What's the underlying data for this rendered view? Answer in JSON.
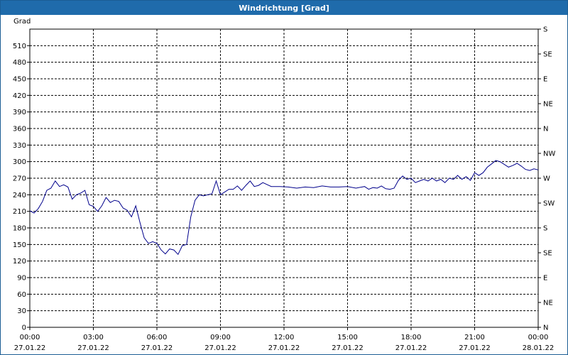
{
  "window": {
    "title": "Windrichtung [Grad]"
  },
  "chart_data": {
    "type": "line",
    "title": "Windrichtung [Grad]",
    "ylabel": "Grad",
    "xlabel": "",
    "ylim": [
      0,
      540
    ],
    "xlim": [
      0,
      24
    ],
    "grid": true,
    "y_ticks": [
      0,
      30,
      60,
      90,
      120,
      150,
      180,
      210,
      240,
      270,
      300,
      330,
      360,
      390,
      420,
      450,
      480,
      510
    ],
    "y2_ticks": [
      {
        "value": 0,
        "label": "N"
      },
      {
        "value": 45,
        "label": "NE"
      },
      {
        "value": 90,
        "label": "E"
      },
      {
        "value": 135,
        "label": "SE"
      },
      {
        "value": 180,
        "label": "S"
      },
      {
        "value": 225,
        "label": "SW"
      },
      {
        "value": 270,
        "label": "W"
      },
      {
        "value": 315,
        "label": "NW"
      },
      {
        "value": 360,
        "label": "N"
      },
      {
        "value": 405,
        "label": "NE"
      },
      {
        "value": 450,
        "label": "E"
      },
      {
        "value": 495,
        "label": "SE"
      },
      {
        "value": 540,
        "label": "S"
      }
    ],
    "x_ticks": [
      {
        "value": 0,
        "time": "00:00",
        "date": "27.01.22"
      },
      {
        "value": 3,
        "time": "03:00",
        "date": "27.01.22"
      },
      {
        "value": 6,
        "time": "06:00",
        "date": "27.01.22"
      },
      {
        "value": 9,
        "time": "09:00",
        "date": "27.01.22"
      },
      {
        "value": 12,
        "time": "12:00",
        "date": "27.01.22"
      },
      {
        "value": 15,
        "time": "15:00",
        "date": "27.01.22"
      },
      {
        "value": 18,
        "time": "18:00",
        "date": "27.01.22"
      },
      {
        "value": 21,
        "time": "21:00",
        "date": "27.01.22"
      },
      {
        "value": 24,
        "time": "00:00",
        "date": "28.01.22"
      }
    ],
    "series": [
      {
        "color": "#00008b",
        "x": [
          0,
          0.2,
          0.4,
          0.6,
          0.8,
          1.0,
          1.2,
          1.4,
          1.6,
          1.8,
          2.0,
          2.2,
          2.4,
          2.6,
          2.8,
          3.0,
          3.2,
          3.4,
          3.6,
          3.8,
          4.0,
          4.2,
          4.4,
          4.6,
          4.8,
          5.0,
          5.2,
          5.4,
          5.6,
          5.8,
          6.0,
          6.2,
          6.4,
          6.6,
          6.8,
          7.0,
          7.2,
          7.4,
          7.6,
          7.8,
          8.0,
          8.2,
          8.4,
          8.6,
          8.8,
          9.0,
          9.2,
          9.4,
          9.6,
          9.8,
          10.0,
          10.2,
          10.4,
          10.6,
          10.8,
          11.0,
          11.4,
          11.8,
          12.2,
          12.6,
          13.0,
          13.4,
          13.8,
          14.2,
          14.6,
          15.0,
          15.4,
          15.8,
          16.0,
          16.2,
          16.4,
          16.6,
          16.8,
          17.0,
          17.2,
          17.4,
          17.6,
          17.8,
          18.0,
          18.2,
          18.4,
          18.6,
          18.8,
          19.0,
          19.2,
          19.4,
          19.6,
          19.8,
          20.0,
          20.2,
          20.4,
          20.6,
          20.8,
          21.0,
          21.2,
          21.4,
          21.6,
          21.8,
          22.0,
          22.2,
          22.4,
          22.6,
          22.8,
          23.0,
          23.2,
          23.4,
          23.6,
          23.8,
          24.0
        ],
        "y": [
          211,
          207,
          215,
          228,
          248,
          252,
          265,
          255,
          258,
          254,
          232,
          240,
          243,
          248,
          222,
          219,
          210,
          220,
          235,
          226,
          230,
          228,
          216,
          212,
          200,
          220,
          190,
          162,
          152,
          155,
          152,
          140,
          133,
          142,
          140,
          132,
          148,
          150,
          200,
          230,
          240,
          238,
          240,
          242,
          265,
          240,
          245,
          250,
          250,
          256,
          248,
          257,
          265,
          255,
          257,
          262,
          255,
          255,
          254,
          252,
          254,
          253,
          256,
          254,
          254,
          255,
          252,
          255,
          250,
          253,
          252,
          256,
          251,
          250,
          252,
          266,
          274,
          268,
          270,
          262,
          265,
          268,
          265,
          270,
          265,
          268,
          262,
          270,
          268,
          275,
          268,
          273,
          266,
          280,
          275,
          280,
          290,
          296,
          302,
          300,
          295,
          290,
          293,
          297,
          292,
          286,
          284,
          287,
          285
        ]
      }
    ]
  }
}
